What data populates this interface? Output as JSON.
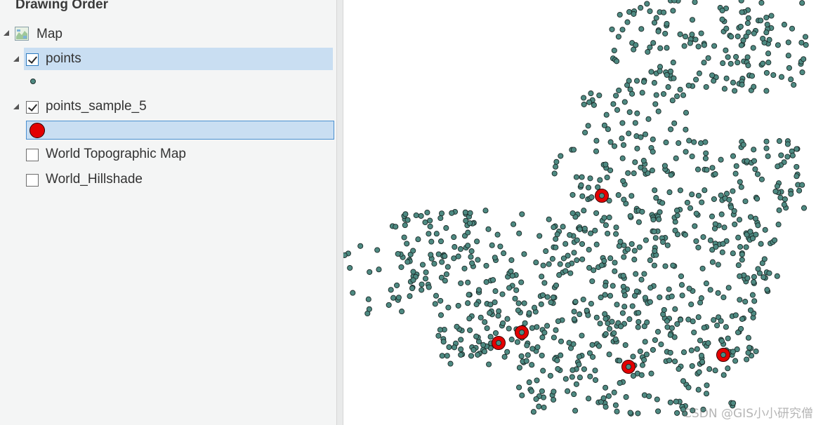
{
  "toc": {
    "title": "Drawing Order",
    "map_item": {
      "label": "Map",
      "icon": "map-icon"
    },
    "layers": [
      {
        "label": "points",
        "checked": true,
        "selected": true,
        "symbol": "teal-dot"
      },
      {
        "label": "points_sample_5",
        "checked": true,
        "selected": false,
        "symbol": "red-dot"
      },
      {
        "label": "World Topographic Map",
        "checked": false
      },
      {
        "label": "World_Hillshade",
        "checked": false
      }
    ]
  },
  "map": {
    "point_color": "#4e8a82",
    "sample_color": "#e30000"
  },
  "watermark": "CSDN @GIS小小研究僧"
}
